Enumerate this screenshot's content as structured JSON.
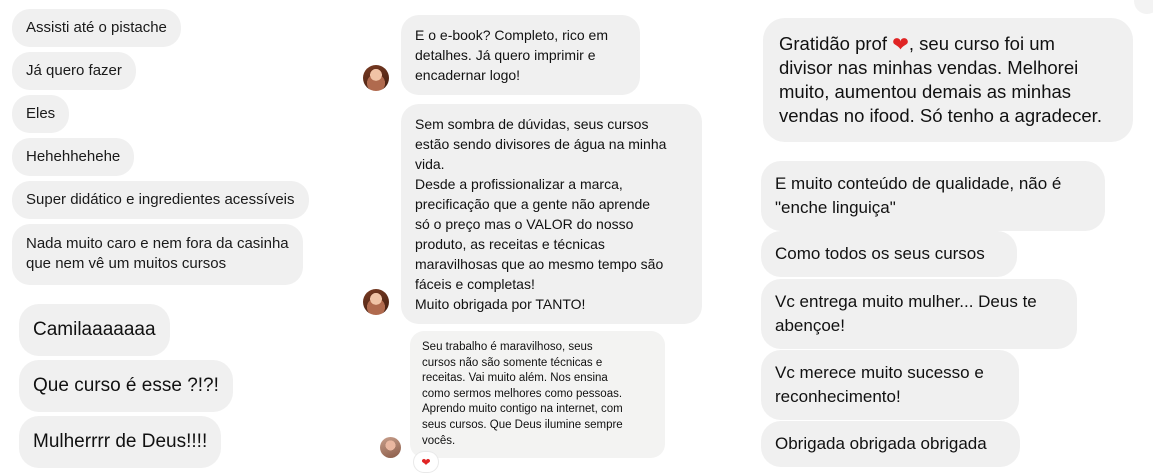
{
  "left_column": {
    "messages_small": [
      "Assisti até o pistache",
      "Já quero fazer",
      "Eles",
      "Hehehhehehe",
      "Super didático e ingredientes acessíveis"
    ],
    "message_multi": [
      "Nada muito caro e nem fora da casinha",
      "que nem vê um muitos cursos"
    ],
    "messages_large": [
      "Camilaaaaaaa",
      "Que curso é esse ?!?!",
      "Mulherrrr de Deus!!!!"
    ]
  },
  "middle_column": {
    "msg1_lines": [
      "E o e-book? Completo, rico em",
      "detalhes. Já quero imprimir e",
      "encadernar logo!"
    ],
    "msg2_lines": [
      "Sem sombra de dúvidas, seus cursos",
      "estão sendo divisores de água na minha",
      "vida.",
      "Desde a profissionalizar a marca,",
      "precificação que a gente não aprende",
      "só o preço mas o VALOR do nosso",
      "produto, as receitas e técnicas",
      "maravilhosas que ao mesmo tempo são",
      "fáceis e completas!",
      "Muito obrigada por TANTO!"
    ],
    "msg3_lines": [
      "Seu trabalho é maravilhoso, seus",
      "cursos não são somente técnicas e",
      "receitas.  Vai muito além. Nos ensina",
      "como sermos melhores como pessoas.",
      "Aprendo muito contigo na internet, com",
      "seus cursos. Que Deus ilumine sempre",
      "vocês."
    ],
    "reaction": "❤"
  },
  "right_column": {
    "big_msg": {
      "line1_before": "Gratidão prof ",
      "heart": "❤",
      "line1_after": ", seu curso foi um",
      "lines": [
        "divisor nas minhas vendas. Melhorei",
        "muito, aumentou demais as minhas",
        "vendas no ifood. Só tenho a agradecer."
      ]
    },
    "msg1_lines": [
      "E muito conteúdo de qualidade, não é",
      "\"enche linguiça\""
    ],
    "msg2_lines": [
      "Como todos os seus cursos"
    ],
    "msg3_lines": [
      "Vc entrega muito mulher... Deus te",
      "abençoe!"
    ],
    "msg4_lines": [
      "Vc merece muito sucesso e",
      "reconhecimento!"
    ],
    "msg5_lines": [
      "Obrigada obrigada obrigada"
    ]
  },
  "colors": {
    "bubble": "#f0f0f0",
    "heart": "#e02424",
    "background": "#ffffff"
  }
}
